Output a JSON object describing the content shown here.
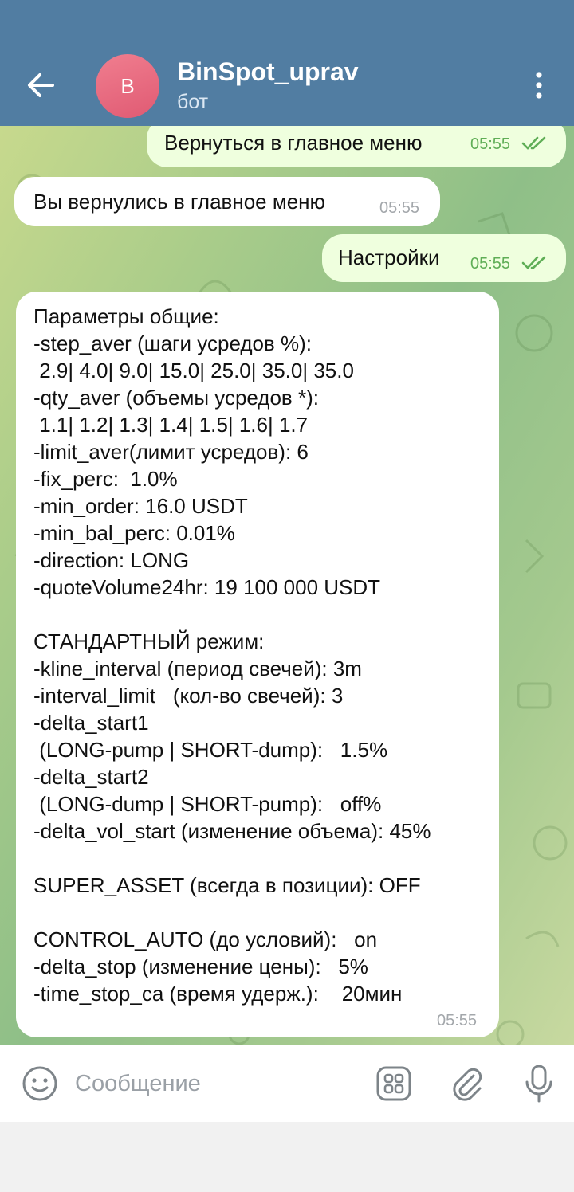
{
  "header": {
    "title": "BinSpot_uprav",
    "subtitle": "бот",
    "avatar_letter": "B",
    "accent_color": "#517da2"
  },
  "messages": [
    {
      "direction": "out",
      "text": "Вернуться в главное меню",
      "time": "05:55",
      "status": "read"
    },
    {
      "direction": "in",
      "text": "Вы вернулись в главное меню",
      "time": "05:55"
    },
    {
      "direction": "out",
      "text": "Настройки",
      "time": "05:55",
      "status": "read"
    },
    {
      "direction": "in",
      "time": "05:55",
      "text": "Параметры общие:\n-step_aver (шаги усредов %):\n 2.9| 4.0| 9.0| 15.0| 25.0| 35.0| 35.0\n-qty_aver (объемы усредов *):\n 1.1| 1.2| 1.3| 1.4| 1.5| 1.6| 1.7\n-limit_aver(лимит усредов): 6\n-fix_perc:  1.0%\n-min_order: 16.0 USDT\n-min_bal_perc: 0.01%\n-direction: LONG\n-quoteVolume24hr: 19 100 000 USDT\n\nСТАНДАРТНЫЙ режим:\n-kline_interval (период свечей): 3m\n-interval_limit   (кол-во свечей): 3\n-delta_start1\n (LONG-pump | SHORT-dump):   1.5%\n-delta_start2\n (LONG-dump | SHORT-pump):   off%\n-delta_vol_start (изменение объема): 45%\n\nSUPER_ASSET (всегда в позиции): OFF\n\nCONTROL_AUTO (до условий):   on\n-delta_stop (изменение цены):   5%\n-time_stop_ca (время удерж.):    20мин"
    }
  ],
  "input": {
    "placeholder": "Сообщение"
  },
  "icons": [
    "back-arrow-icon",
    "more-vertical-icon",
    "emoji-icon",
    "bot-menu-icon",
    "attach-icon",
    "mic-icon",
    "double-check-icon"
  ]
}
